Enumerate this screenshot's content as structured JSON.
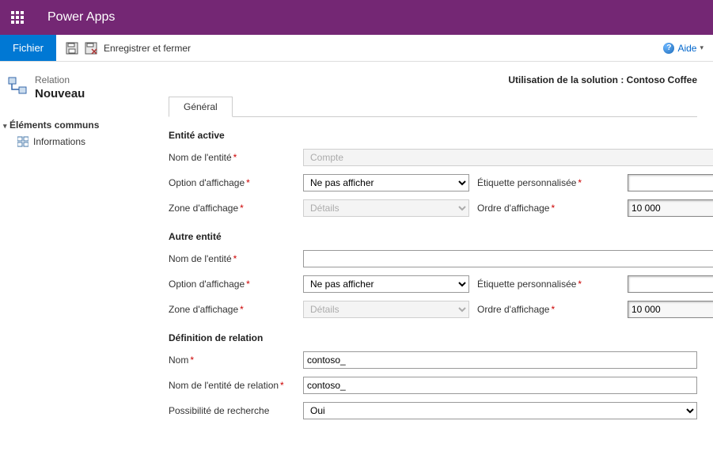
{
  "app": {
    "title": "Power Apps"
  },
  "commandbar": {
    "fichier": "Fichier",
    "save_close": "Enregistrer et fermer",
    "help": "Aide"
  },
  "context_bar": {
    "label": "Utilisation de la solution : ",
    "value": "Contoso Coffee"
  },
  "header": {
    "type": "Relation",
    "name": "Nouveau"
  },
  "nav": {
    "root": "Éléments communs",
    "child": "Informations"
  },
  "tabs": {
    "general": "Général"
  },
  "sections": {
    "active": {
      "title": "Entité active",
      "entity_name_label": "Nom de l'entité",
      "entity_name_value": "Compte",
      "display_option_label": "Option d'affichage",
      "display_option_value": "Ne pas afficher",
      "custom_label_label": "Étiquette personnalisée",
      "custom_label_value": "",
      "display_area_label": "Zone d'affichage",
      "display_area_value": "Détails",
      "display_order_label": "Ordre d'affichage",
      "display_order_value": "10 000"
    },
    "other": {
      "title": "Autre entité",
      "entity_name_label": "Nom de l'entité",
      "entity_name_value": "",
      "display_option_label": "Option d'affichage",
      "display_option_value": "Ne pas afficher",
      "custom_label_label": "Étiquette personnalisée",
      "custom_label_value": "",
      "display_area_label": "Zone d'affichage",
      "display_area_value": "Détails",
      "display_order_label": "Ordre d'affichage",
      "display_order_value": "10 000"
    },
    "relation": {
      "title": "Définition de relation",
      "name_label": "Nom",
      "name_value": "contoso_",
      "rel_entity_label": "Nom de l'entité de relation",
      "rel_entity_value": "contoso_",
      "searchable_label": "Possibilité de recherche",
      "searchable_value": "Oui"
    }
  }
}
